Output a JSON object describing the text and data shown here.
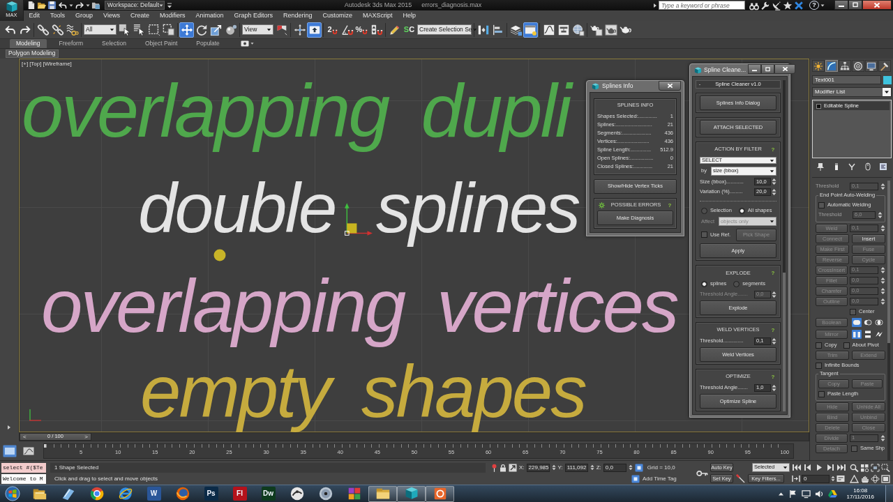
{
  "title_bar": {
    "app_button": "MAX",
    "workspace": "Workspace: Default",
    "title": "Autodesk 3ds Max 2015",
    "file": "errors_diagnosis.max",
    "search": {
      "placeholder": "Type a keyword or phrase"
    },
    "help": "?"
  },
  "menu": [
    "Edit",
    "Tools",
    "Group",
    "Views",
    "Create",
    "Modifiers",
    "Animation",
    "Graph Editors",
    "Rendering",
    "Customize",
    "MAXScript",
    "Help"
  ],
  "toolbar": [
    {
      "kind": "button",
      "selected": false
    },
    {
      "kind": "button",
      "selected": false
    },
    {
      "kind": "button",
      "selected": false
    },
    {
      "kind": "button",
      "selected": false
    },
    {
      "kind": "button",
      "selected": false
    },
    {
      "kind": "dropdown",
      "value": "All"
    },
    {
      "kind": "button",
      "selected": false
    },
    {
      "kind": "button",
      "selected": false
    },
    {
      "kind": "button",
      "selected": false
    },
    {
      "kind": "button",
      "selected": false
    },
    {
      "kind": "button",
      "selected": true
    },
    {
      "kind": "button",
      "selected": false
    },
    {
      "kind": "button",
      "selected": false
    },
    {
      "kind": "button",
      "selected": false
    },
    {
      "kind": "dropdown",
      "value": "View"
    },
    {
      "kind": "button",
      "selected": false
    },
    {
      "kind": "button",
      "selected": false
    },
    {
      "kind": "button",
      "selected": true
    },
    {
      "kind": "glyph",
      "text": "2",
      "selected": false
    },
    {
      "kind": "button",
      "selected": false
    },
    {
      "kind": "glyph",
      "text": "%",
      "selected": false
    },
    {
      "kind": "button",
      "selected": false
    },
    {
      "kind": "button",
      "selected": false
    },
    {
      "kind": "glyph",
      "text": "SC",
      "selected": false
    },
    {
      "kind": "dropdown",
      "value": "Create Selection Se"
    },
    {
      "kind": "button",
      "selected": false
    },
    {
      "kind": "button",
      "selected": false
    },
    {
      "kind": "button",
      "selected": false
    },
    {
      "kind": "button",
      "selected": true
    },
    {
      "kind": "button",
      "selected": false
    },
    {
      "kind": "button",
      "selected": false
    },
    {
      "kind": "button",
      "selected": false
    },
    {
      "kind": "button",
      "selected": false
    },
    {
      "kind": "button",
      "selected": false
    },
    {
      "kind": "button",
      "selected": false
    }
  ],
  "ribbon": {
    "tabs": [
      {
        "label": "Modeling",
        "selected": true
      },
      {
        "label": "Freeform",
        "selected": false
      },
      {
        "label": "Selection",
        "selected": false
      },
      {
        "label": "Object Paint",
        "selected": false
      },
      {
        "label": "Populate",
        "selected": false
      }
    ],
    "panel": "Polygon Modeling"
  },
  "viewport": {
    "labels": [
      "[+]",
      "[Top]",
      "[Wireframe]"
    ],
    "texts": [
      {
        "text": "overlapping dupli",
        "color": "#4fa84c"
      },
      {
        "text": "double",
        "color": "#e4e4e4"
      },
      {
        "text": "splines",
        "color": "#e4e4e4"
      },
      {
        "text": "overlapping vertices",
        "color": "#d6a6c8"
      },
      {
        "text": "empty shapes",
        "color": "#c6ab3e"
      }
    ]
  },
  "splines_info": {
    "title": "Splines Info",
    "section": "SPLINES INFO",
    "stats": [
      {
        "label": "Shapes Selected:.............",
        "value": "1"
      },
      {
        "label": "Splines:.........................",
        "value": "21"
      },
      {
        "label": "Segments:....................",
        "value": "436"
      },
      {
        "label": "Vertices:......................",
        "value": "436"
      },
      {
        "label": "Spline Length:..............",
        "value": "512.9"
      },
      {
        "label": "Open Splines:................",
        "value": "0"
      },
      {
        "label": "Closed Splines:.............",
        "value": "21"
      }
    ],
    "ticks_button": "Show/Hide Vertex Ticks",
    "errors": {
      "title": "POSSIBLE ERRORS",
      "help": "?",
      "button": "Make Diagnosis"
    }
  },
  "spline_cleaner": {
    "title": "Spline Cleane...",
    "rollout": {
      "toggle": "-",
      "title": "Spline Cleaner v1.0"
    },
    "groups": [
      {
        "rows": [
          {
            "kind": "button",
            "label": "Splines Info Dialog"
          }
        ]
      },
      {
        "rows": [
          {
            "kind": "button",
            "label": "ATTACH SELECTED"
          }
        ]
      },
      {
        "title": "ACTION BY FILTER",
        "help": "?",
        "rows": [
          {
            "kind": "dropdown",
            "value": "SELECT",
            "disabled": false
          },
          {
            "kind": "dropdown",
            "label": "by",
            "value": "size (bbox)",
            "disabled": false
          },
          {
            "kind": "spinner",
            "label": "Size (bbox)............",
            "value": "10,0",
            "disabled": false
          },
          {
            "kind": "spinner",
            "label": "Variation (%).........",
            "value": "20,0",
            "disabled": false
          },
          {
            "kind": "separator"
          },
          {
            "kind": "radios",
            "options": [
              {
                "label": "Selection",
                "selected": false
              },
              {
                "label": "All shapes",
                "selected": true
              }
            ]
          },
          {
            "kind": "dropdown",
            "label": "Affect",
            "value": "objects only",
            "disabled": true
          },
          {
            "kind": "check_button",
            "label": "Use Ref.",
            "checked": false,
            "button": "Pick Shape",
            "disabled": true
          },
          {
            "kind": "button",
            "label": "Apply"
          }
        ]
      },
      {
        "title": "EXPLODE",
        "help": "?",
        "rows": [
          {
            "kind": "radios",
            "options": [
              {
                "label": "splines",
                "selected": true
              },
              {
                "label": "segments",
                "selected": false
              }
            ]
          },
          {
            "kind": "spinner",
            "label": "Threshold Angle.......",
            "value": "0,0",
            "disabled": true
          },
          {
            "kind": "button",
            "label": "Explode"
          }
        ]
      },
      {
        "title": "WELD VERTICES",
        "help": "?",
        "rows": [
          {
            "kind": "spinner",
            "label": "Threshold..............",
            "value": "0,1",
            "disabled": false
          },
          {
            "kind": "button",
            "label": "Weld Vertices"
          }
        ]
      },
      {
        "title": "OPTIMIZE",
        "help": "?",
        "rows": [
          {
            "kind": "spinner",
            "label": "Threshold Angle.......",
            "value": "1,0",
            "disabled": false
          },
          {
            "kind": "button",
            "label": "Optimize Spline"
          }
        ]
      }
    ]
  },
  "command_panel": {
    "tabs": [
      {
        "selected": false
      },
      {
        "selected": true
      },
      {
        "selected": false
      },
      {
        "selected": false
      },
      {
        "selected": false
      },
      {
        "selected": false
      }
    ],
    "object": {
      "name": "Text001",
      "color": "#3fc3de"
    },
    "modifier_list": "Modifier List",
    "stack": [
      "Editable Spline"
    ],
    "rollout": [
      {
        "kind": "spinner",
        "label": "Threshold",
        "value": "0,1",
        "disabled": true
      },
      {
        "kind": "group",
        "title": "End Point Auto-Welding",
        "rows": [
          {
            "kind": "checks",
            "items": [
              {
                "label": "Automatic Welding",
                "checked": false
              }
            ]
          },
          {
            "kind": "spinner",
            "label": "Threshold",
            "value": "6,0",
            "disabled": true
          }
        ]
      },
      {
        "kind": "button_spinner",
        "label": "Weld",
        "value": "0,1",
        "disabled": true
      },
      {
        "kind": "pair",
        "buttons": [
          {
            "label": "Connect",
            "disabled": true
          },
          {
            "label": "Insert",
            "disabled": false
          }
        ]
      },
      {
        "kind": "pair",
        "buttons": [
          {
            "label": "Make First",
            "disabled": true
          },
          {
            "label": "Fuse",
            "disabled": true
          }
        ]
      },
      {
        "kind": "pair",
        "buttons": [
          {
            "label": "Reverse",
            "disabled": true
          },
          {
            "label": "Cycle",
            "disabled": true
          }
        ]
      },
      {
        "kind": "button_spinner",
        "label": "CrossInsert",
        "value": "0,1",
        "disabled": true
      },
      {
        "kind": "button_spinner",
        "label": "Fillet",
        "value": "0,0",
        "disabled": true
      },
      {
        "kind": "button_spinner",
        "label": "Chamfer",
        "value": "0,0",
        "disabled": true
      },
      {
        "kind": "button_spinner",
        "label": "Outline",
        "value": "0,0",
        "disabled": true
      },
      {
        "kind": "check_right",
        "label": "Center",
        "checked": false
      },
      {
        "kind": "button_icons",
        "label": "Boolean",
        "disabled": true,
        "icons": [
          {
            "selected": true
          },
          {
            "selected": false
          },
          {
            "selected": false
          }
        ]
      },
      {
        "kind": "button_icons",
        "label": "Mirror",
        "disabled": true,
        "icons": [
          {
            "selected": true
          },
          {
            "selected": false
          },
          {
            "selected": false
          }
        ]
      },
      {
        "kind": "checks",
        "items": [
          {
            "label": "Copy",
            "checked": false
          },
          {
            "label": "About Pivot",
            "checked": false
          }
        ]
      },
      {
        "kind": "pair",
        "buttons": [
          {
            "label": "Trim",
            "disabled": true
          },
          {
            "label": "Extend",
            "disabled": true
          }
        ]
      },
      {
        "kind": "checks",
        "items": [
          {
            "label": "Infinite Bounds",
            "checked": false
          }
        ]
      },
      {
        "kind": "group",
        "title": "Tangent",
        "rows": [
          {
            "kind": "pair",
            "buttons": [
              {
                "label": "Copy",
                "disabled": true
              },
              {
                "label": "Paste",
                "disabled": true
              }
            ]
          },
          {
            "kind": "checks",
            "items": [
              {
                "label": "Paste Length",
                "checked": false
              }
            ]
          }
        ]
      },
      {
        "kind": "pair",
        "buttons": [
          {
            "label": "Hide",
            "disabled": true
          },
          {
            "label": "Unhide All",
            "disabled": true
          }
        ]
      },
      {
        "kind": "pair",
        "buttons": [
          {
            "label": "Bind",
            "disabled": true
          },
          {
            "label": "Unbind",
            "disabled": true
          }
        ]
      },
      {
        "kind": "pair",
        "buttons": [
          {
            "label": "Delete",
            "disabled": true
          },
          {
            "label": "Close",
            "disabled": true
          }
        ]
      },
      {
        "kind": "button_spinner",
        "label": "Divide",
        "value": "1",
        "disabled": true
      },
      {
        "kind": "button_check",
        "label": "Detach",
        "disabled": true,
        "check": {
          "label": "Same Shp",
          "checked": false
        }
      }
    ]
  },
  "timeline": {
    "prev": "<",
    "counter": "0 / 100",
    "next": ">",
    "level": 0,
    "ticks": [
      "5",
      "10",
      "15",
      "20",
      "25",
      "30",
      "35",
      "40",
      "45",
      "50",
      "55",
      "60",
      "65",
      "70",
      "75",
      "80",
      "85",
      "90",
      "95",
      "100"
    ]
  },
  "status": {
    "listener": {
      "input": "select #($Te",
      "output": "Welcome to M"
    },
    "selection": "1 Shape Selected",
    "prompt": "Click and drag to select and move objects",
    "coords": [
      {
        "axis": "X:",
        "value": "229,985"
      },
      {
        "axis": "Y:",
        "value": "111,092"
      },
      {
        "axis": "Z:",
        "value": "0,0"
      }
    ],
    "grid": "Grid = 10,0",
    "time_tag": "Add Time Tag",
    "auto_key": "Auto Key",
    "key_set": "Selected",
    "set_key": "Set Key",
    "key_filters": "Key Filters...",
    "frame": "0"
  },
  "taskbar": {
    "apps": [
      {
        "kind": "icon",
        "running": false
      },
      {
        "kind": "icon",
        "running": false
      },
      {
        "kind": "icon",
        "running": false
      },
      {
        "kind": "icon",
        "running": false
      },
      {
        "kind": "letter",
        "text": "W",
        "color": "#2a5699",
        "running": false
      },
      {
        "kind": "icon",
        "running": false
      },
      {
        "kind": "letter",
        "text": "Ps",
        "color": "#0b2a47",
        "running": false
      },
      {
        "kind": "letter",
        "text": "Fl",
        "color": "#b5121b",
        "running": false
      },
      {
        "kind": "letter",
        "text": "Dw",
        "color": "#0e3b1e",
        "running": false
      },
      {
        "kind": "icon",
        "running": false
      },
      {
        "kind": "icon",
        "running": false
      },
      {
        "kind": "icon",
        "running": false
      },
      {
        "kind": "icon",
        "running": true
      },
      {
        "kind": "icon",
        "running": true
      },
      {
        "kind": "icon",
        "running": true
      }
    ],
    "time": "16:08",
    "date": "17/11/2016"
  }
}
